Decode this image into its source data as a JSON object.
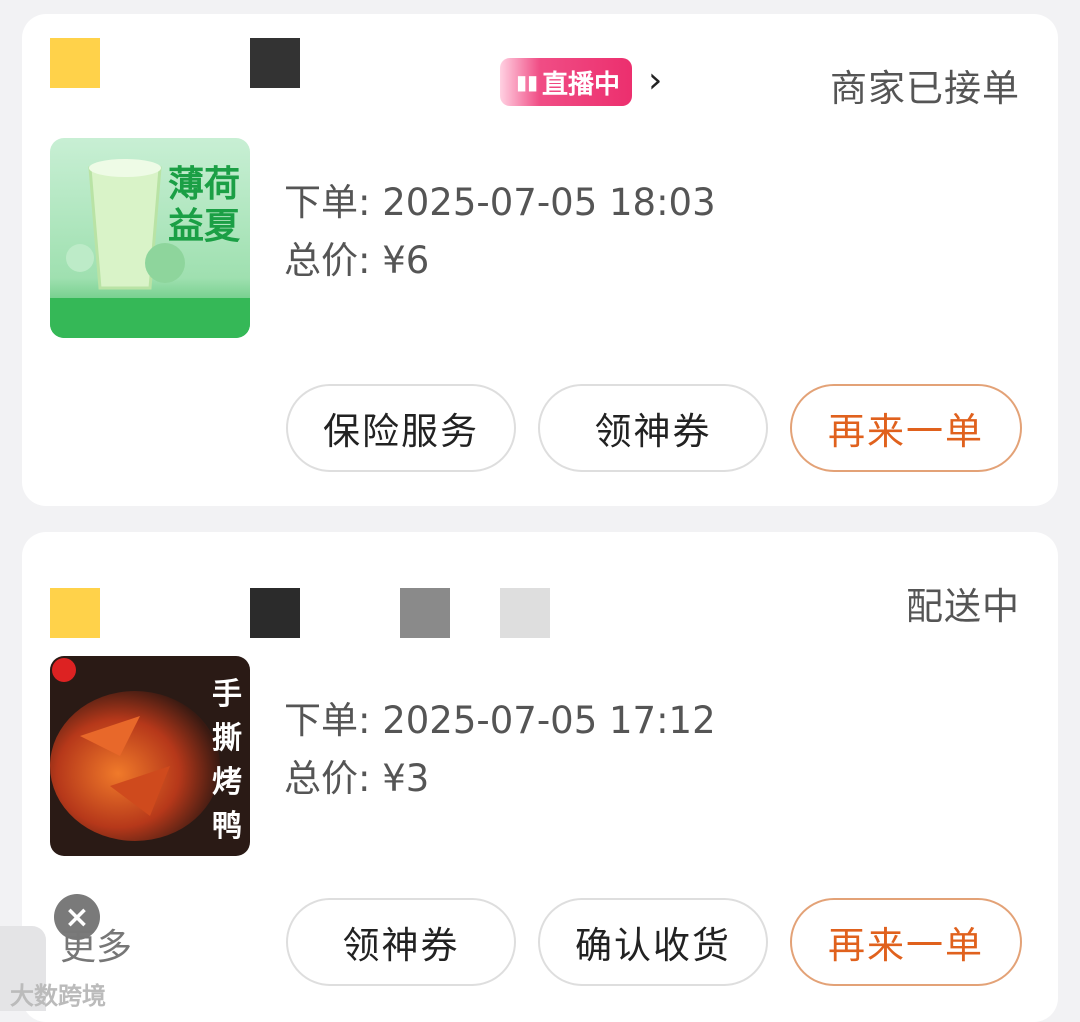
{
  "orders": [
    {
      "status": "商家已接单",
      "live_badge": "直播中",
      "thumb_caption": "薄荷益夏",
      "order_time": "下单: 2025-07-05 18:03",
      "total_price": "总价: ¥6",
      "buttons": [
        "保险服务",
        "领神券",
        "再来一单"
      ]
    },
    {
      "status": "配送中",
      "thumb_caption": "手撕烤鸭",
      "order_time": "下单: 2025-07-05 17:12",
      "total_price": "总价: ¥3",
      "buttons": [
        "领神券",
        "确认收货",
        "再来一单"
      ]
    }
  ],
  "more_label": "更多",
  "watermark": "大数跨境",
  "colors": {
    "accent": "#e0611d",
    "live_pink": "#ec2f6e"
  }
}
